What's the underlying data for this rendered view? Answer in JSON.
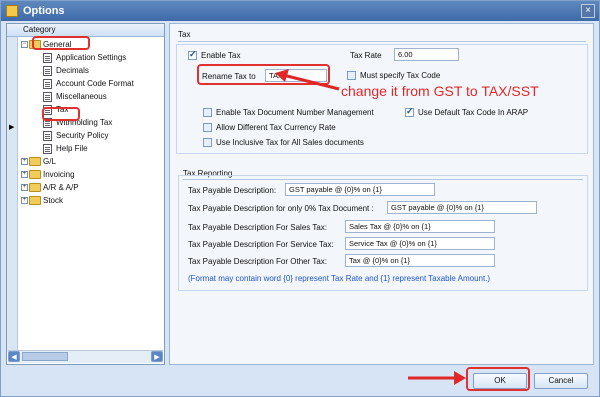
{
  "window": {
    "title": "Options",
    "close_label": "×"
  },
  "category": {
    "header": "Category",
    "items": [
      {
        "label": "General",
        "level": 0,
        "type": "folder",
        "expander": "−"
      },
      {
        "label": "Application Settings",
        "level": 1,
        "type": "doc"
      },
      {
        "label": "Decimals",
        "level": 1,
        "type": "doc"
      },
      {
        "label": "Account Code Format",
        "level": 1,
        "type": "doc"
      },
      {
        "label": "Miscellaneous",
        "level": 1,
        "type": "doc"
      },
      {
        "label": "Tax",
        "level": 1,
        "type": "doc",
        "selected": true
      },
      {
        "label": "Withholding Tax",
        "level": 1,
        "type": "doc"
      },
      {
        "label": "Security Policy",
        "level": 1,
        "type": "doc"
      },
      {
        "label": "Help File",
        "level": 1,
        "type": "doc"
      },
      {
        "label": "G/L",
        "level": 0,
        "type": "folder",
        "expander": "+"
      },
      {
        "label": "Invoicing",
        "level": 0,
        "type": "folder",
        "expander": "+"
      },
      {
        "label": "A/R & A/P",
        "level": 0,
        "type": "folder",
        "expander": "+"
      },
      {
        "label": "Stock",
        "level": 0,
        "type": "folder",
        "expander": "+"
      }
    ],
    "scroll_left": "◀",
    "scroll_right": "▶",
    "gutter_arrow": "▶"
  },
  "tax": {
    "section_title": "Tax",
    "enable_tax_label": "Enable Tax",
    "enable_tax_checked": true,
    "tax_rate_label": "Tax Rate",
    "tax_rate_value": "6.00",
    "rename_label": "Rename Tax to",
    "rename_value": "TAX",
    "must_specify_label": "Must specify Tax Code",
    "must_specify_checked": false,
    "doc_number_label": "Enable Tax Document Number Management",
    "doc_number_checked": false,
    "default_code_label": "Use Default Tax Code In ARAP",
    "default_code_checked": true,
    "diff_currency_label": "Allow Different Tax Currency Rate",
    "diff_currency_checked": false,
    "inclusive_label": "Use Inclusive Tax for All Sales documents",
    "inclusive_checked": false
  },
  "annotation": {
    "text": "change it from GST to TAX/SST",
    "color": "#e02828"
  },
  "reporting": {
    "section_title": "Tax Reporting",
    "rows": [
      {
        "label": "Tax Payable Description:",
        "value": "GST payable @ {0}% on {1}"
      },
      {
        "label": "Tax Payable Description for only 0% Tax Document :",
        "value": "GST payable @ {0}% on {1}"
      },
      {
        "label": "Tax Payable Description For Sales Tax:",
        "value": "Sales Tax @ {0}% on {1}"
      },
      {
        "label": "Tax Payable Description For Service Tax:",
        "value": "Service Tax @ {0}% on {1}"
      },
      {
        "label": "Tax Payable Description For Other Tax:",
        "value": "Tax @ {0}% on {1}"
      }
    ],
    "note": "(Format may contain word {0} represent Tax Rate and {1} represent Taxable Amount.)"
  },
  "buttons": {
    "ok": "OK",
    "cancel": "Cancel"
  }
}
